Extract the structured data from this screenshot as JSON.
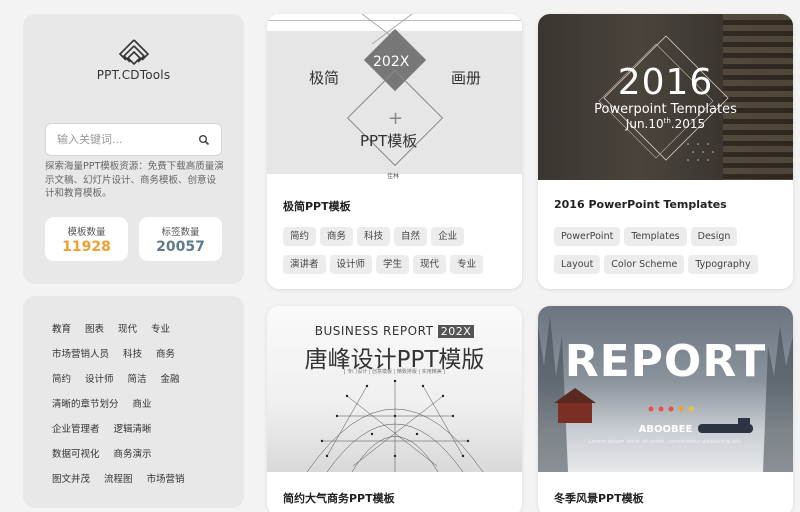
{
  "sidebar": {
    "logo_text": "PPT.CDTools",
    "search_placeholder": "输入关键词...",
    "description": "探索海量PPT模板资源：免费下载高质量演示文稿、幻灯片设计、商务模板、创意设计和教育模板。",
    "stats": [
      {
        "label": "模板数量",
        "value": "11928",
        "color": "#f0a030"
      },
      {
        "label": "标签数量",
        "value": "20057",
        "color": "#5e7a8e"
      }
    ]
  },
  "tags": {
    "rows": [
      [
        "教育",
        "图表",
        "现代",
        "专业"
      ],
      [
        "市场营销人员",
        "科技",
        "商务"
      ],
      [
        "简约",
        "设计师",
        "简洁",
        "金融"
      ],
      [
        "清晰的章节划分",
        "商业"
      ],
      [
        "企业管理者",
        "逻辑清晰"
      ],
      [
        "数据可视化",
        "商务演示"
      ],
      [
        "图文并茂",
        "流程图",
        "市场营销"
      ]
    ]
  },
  "cards": [
    {
      "title": "极简PPT模板",
      "tags": [
        "简约",
        "商务",
        "科技",
        "自然",
        "企业",
        "演讲者",
        "设计师",
        "学生",
        "现代",
        "专业"
      ],
      "thumb": {
        "left": "极简",
        "badge": "202X",
        "right": "画册",
        "plus": "+",
        "main": "PPT模板",
        "foot": "佳林"
      }
    },
    {
      "title": "2016 PowerPoint Templates",
      "tags": [
        "PowerPoint",
        "Templates",
        "Design",
        "Layout",
        "Color Scheme",
        "Typography"
      ],
      "thumb": {
        "year": "2016",
        "sub": "Powerpoint  Templates",
        "date": "Jun.10",
        "date_sup": "th",
        "date_year": ".2015"
      }
    },
    {
      "title": "简约大气商务PPT模板",
      "tags": [],
      "thumb": {
        "en": "BUSINESS REPORT",
        "badge": "202X",
        "cn": "唐峰设计PPT模版",
        "tiny": "[ 专门设计 | 创意模板 | 精致排版 | 实用精美 ]"
      }
    },
    {
      "title": "冬季风景PPT模板",
      "tags": [],
      "thumb": {
        "big": "REPORT",
        "brand": "ABOOBEE",
        "lorem": "Lorem ipsum dolor sit amet, consectetur adipiscing elit."
      }
    }
  ]
}
